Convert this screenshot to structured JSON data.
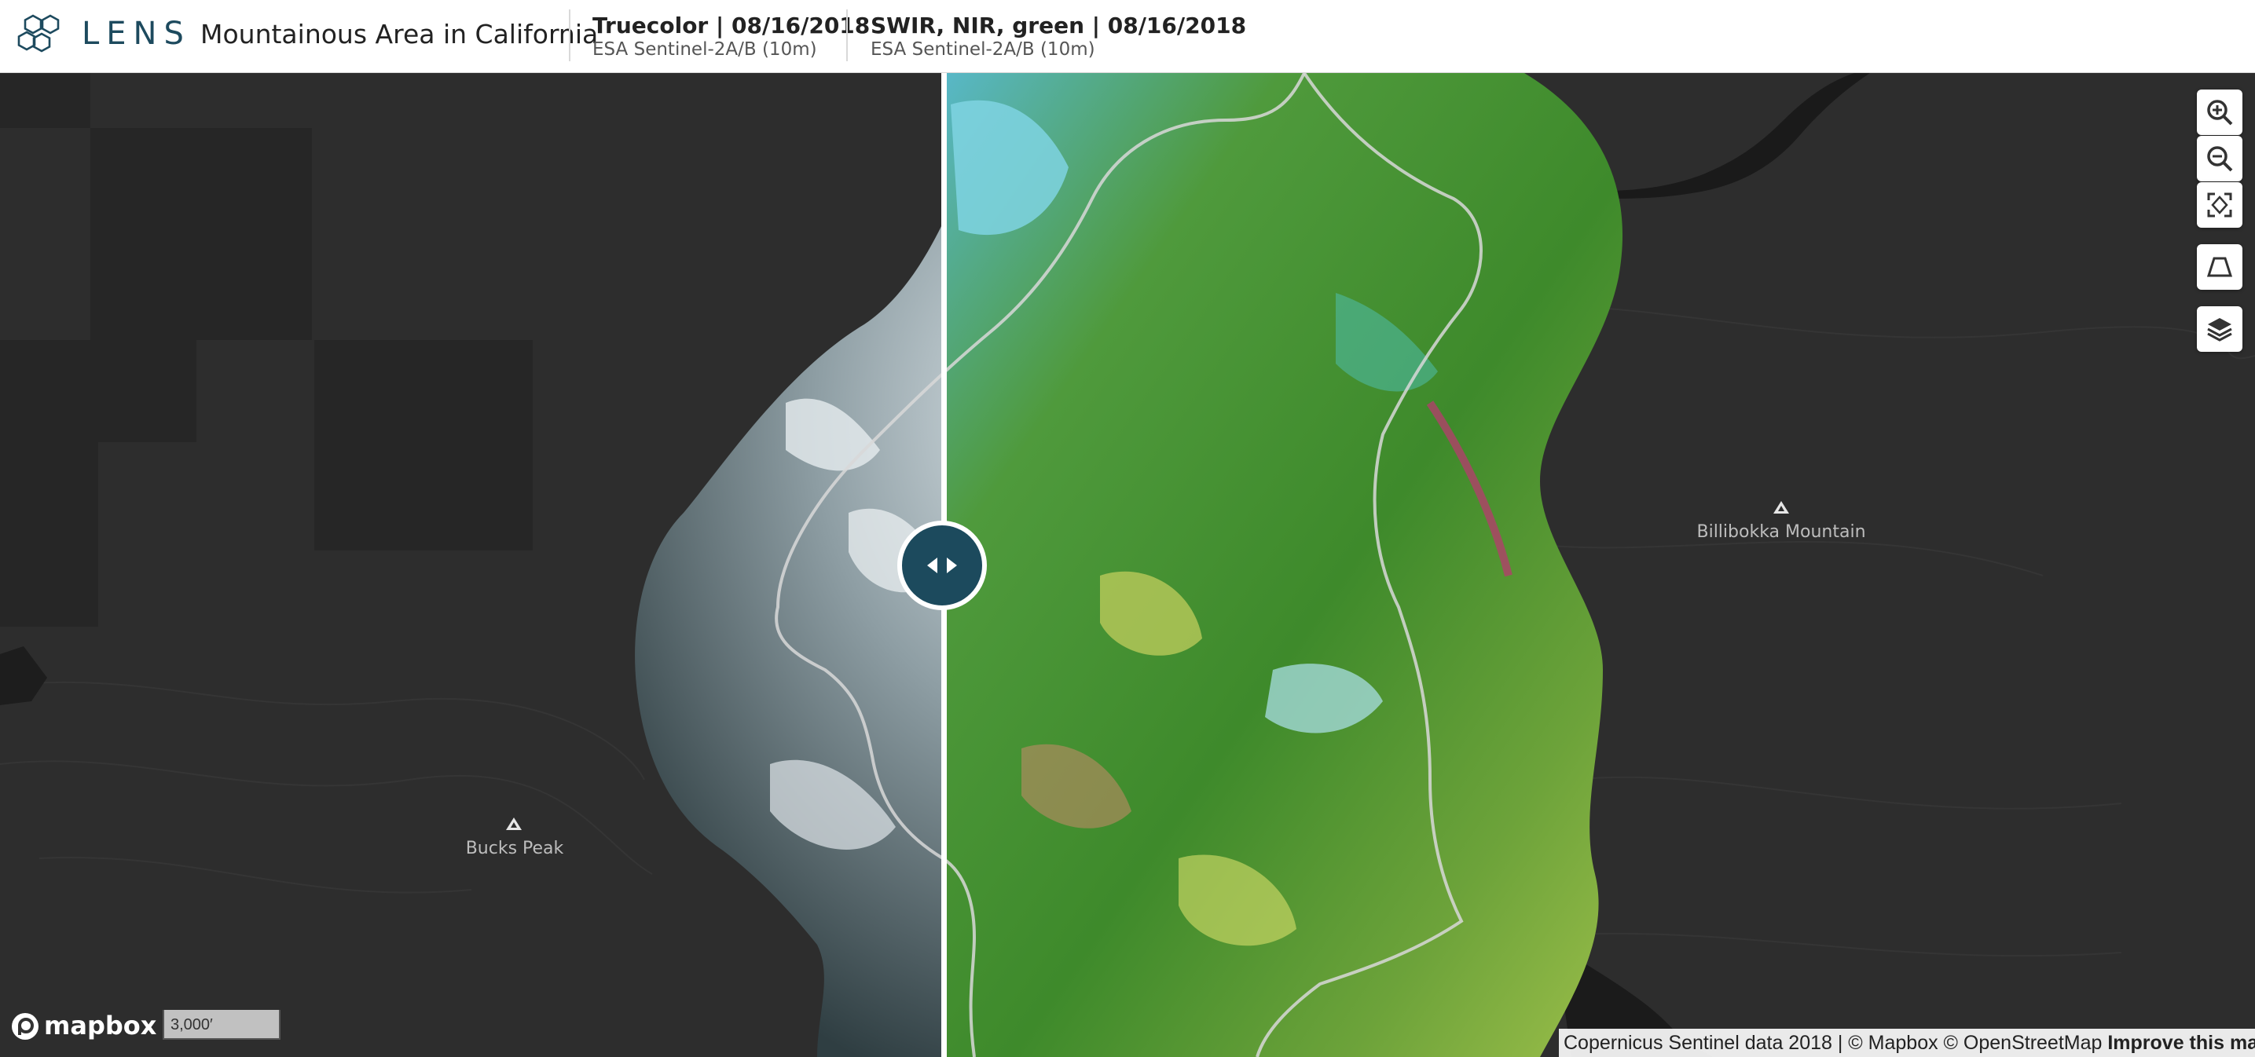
{
  "header": {
    "brand": "LENS",
    "title": "Mountainous Area in California",
    "left_layer": {
      "title": "Truecolor | 08/16/2018",
      "source": "ESA Sentinel-2A/B (10m)"
    },
    "right_layer": {
      "title": "SWIR, NIR, green | 08/16/2018",
      "source": "ESA Sentinel-2A/B (10m)"
    }
  },
  "map": {
    "labels": {
      "peak_left": "Bucks Peak",
      "peak_right": "Billibokka Mountain"
    },
    "scale_text": "3,000′",
    "mapbox_logo_text": "mapbox",
    "attribution": {
      "text": "Copernicus Sentinel data 2018 | © Mapbox © OpenStreetMap",
      "link": "Improve this map"
    }
  },
  "controls": [
    {
      "name": "zoom-in",
      "icon": "zoom-in-icon"
    },
    {
      "name": "zoom-out",
      "icon": "zoom-out-icon"
    },
    {
      "name": "fit-bounds",
      "icon": "fit-bounds-icon"
    },
    {
      "name": "perspective",
      "icon": "perspective-icon"
    },
    {
      "name": "layers",
      "icon": "layers-icon"
    }
  ],
  "colors": {
    "brand": "#1d4a5e",
    "map_background": "#2b2b2b",
    "swipe_handle": "#1c4a5d"
  }
}
